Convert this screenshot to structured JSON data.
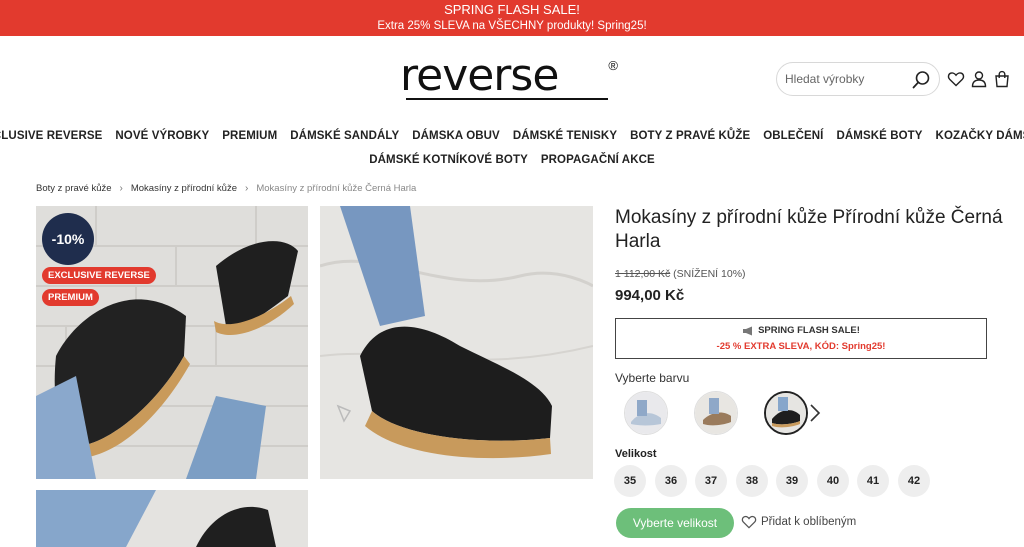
{
  "promo": {
    "line1": "SPRING FLASH SALE!",
    "line2": "Extra 25% SLEVA na VŠECHNY produkty! Spring25!"
  },
  "logo": {
    "text": "reverse",
    "reg": "®"
  },
  "search": {
    "placeholder": "Hledat výrobky"
  },
  "header_icons": [
    "search-icon",
    "heart-icon",
    "user-icon",
    "shopping-bag-icon"
  ],
  "nav": {
    "row1": [
      "EXCLUSIVE REVERSE",
      "NOVÉ VÝROBKY",
      "PREMIUM",
      "DÁMSKÉ SANDÁLY",
      "DÁMSKA OBUV",
      "DÁMSKÉ TENISKY",
      "BOTY Z PRAVÉ KŮŽE",
      "OBLEČENÍ",
      "DÁMSKÉ BOTY",
      "KOZAČKY DÁMSKÉ"
    ],
    "row2": [
      "DÁMSKÉ KOTNÍKOVÉ BOTY",
      "PROPAGAČNÍ AKCE"
    ]
  },
  "breadcrumb": [
    "Boty z pravé kůže",
    "Mokasíny z přírodní kůže",
    "Mokasíny z přírodní kůže Černá Harla"
  ],
  "badges": {
    "discount": "-10%",
    "exclusive": "EXCLUSIVE REVERSE",
    "premium": "PREMIUM"
  },
  "product": {
    "title": "Mokasíny z přírodní kůže Přírodní kůže Černá Harla",
    "price_old": "1 112,00 Kč",
    "price_note": " (SNÍŽENÍ 10%)",
    "price_new": "994,00 Kč"
  },
  "flash_box": {
    "line1": "SPRING FLASH SALE!",
    "line2": "-25 % EXTRA SLEVA, KÓD: Spring25!"
  },
  "colors": {
    "label": "Vyberte barvu",
    "swatch_count": 3,
    "selected_index": 2
  },
  "sizes": {
    "label": "Velikost",
    "values": [
      "35",
      "36",
      "37",
      "38",
      "39",
      "40",
      "41",
      "42"
    ]
  },
  "actions": {
    "choose_size": "Vyberte velikost",
    "add_favorite": "Přidat k oblíbeným"
  },
  "colors_palette": {
    "accent_red": "#e23a2e",
    "cta_green": "#6dbf7a",
    "badge_navy": "#1f2d4d"
  }
}
